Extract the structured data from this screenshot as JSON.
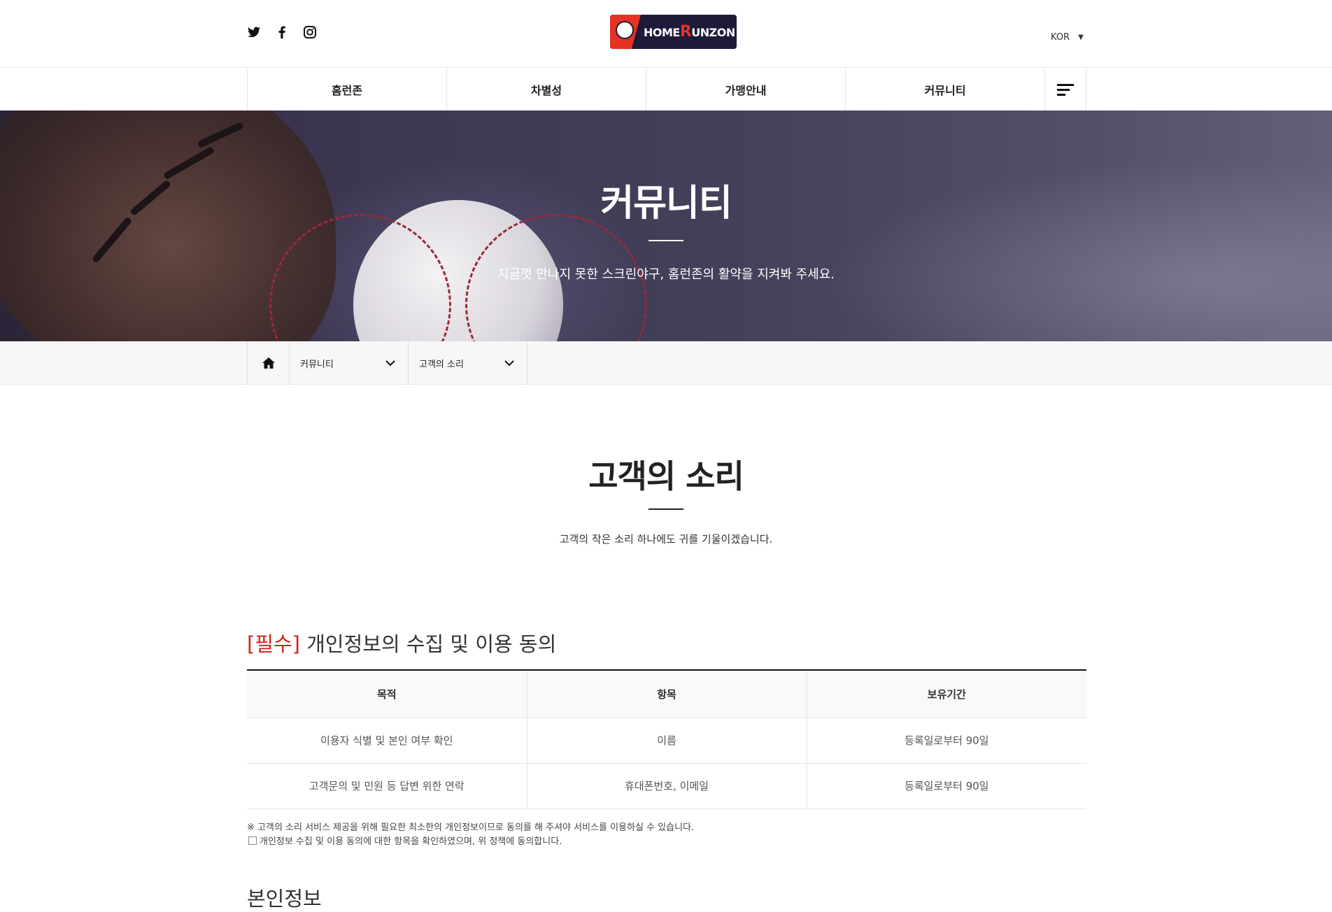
{
  "header": {
    "social": [
      "twitter-icon",
      "facebook-icon",
      "instagram-icon"
    ],
    "logo_text_a": "HOME",
    "logo_text_b": "R",
    "logo_text_c": "UNZON",
    "lang": "KOR"
  },
  "nav": {
    "items": [
      "홈런존",
      "차별성",
      "가맹안내",
      "커뮤니티"
    ]
  },
  "hero": {
    "title": "커뮤니티",
    "subtitle": "지금껏 만나지 못한 스크린야구, 홈런존의 활약을 지켜봐 주세요."
  },
  "breadcrumb": {
    "level1": "커뮤니티",
    "level2": "고객의 소리"
  },
  "section": {
    "title": "고객의 소리",
    "subtitle": "고객의 작은 소리 하나에도 귀를 기울이겠습니다."
  },
  "privacy": {
    "required": "[필수]",
    "heading": " 개인정보의 수집 및 이용 동의",
    "columns": [
      "목적",
      "항목",
      "보유기간"
    ],
    "rows": [
      [
        "이용자 식별 및 본인 여부 확인",
        "이름",
        "등록일로부터 90일"
      ],
      [
        "고객문의 및 민원 등 답변 위한 연락",
        "휴대폰번호, 이메일",
        "등록일로부터 90일"
      ]
    ],
    "note": "※ 고객의 소리 서비스 제공을 위해 필요한 최소한의 개인정보이므로 동의를 해 주셔야 서비스를 이용하실 수 있습니다.",
    "agree": "개인정보 수집 및 이용 동의에 대한 항목을 확인하였으며, 위 정책에 동의합니다."
  },
  "next_heading": "본인정보",
  "colors": {
    "accent": "#d2231a",
    "logo_bg": "#1e1a3a"
  }
}
